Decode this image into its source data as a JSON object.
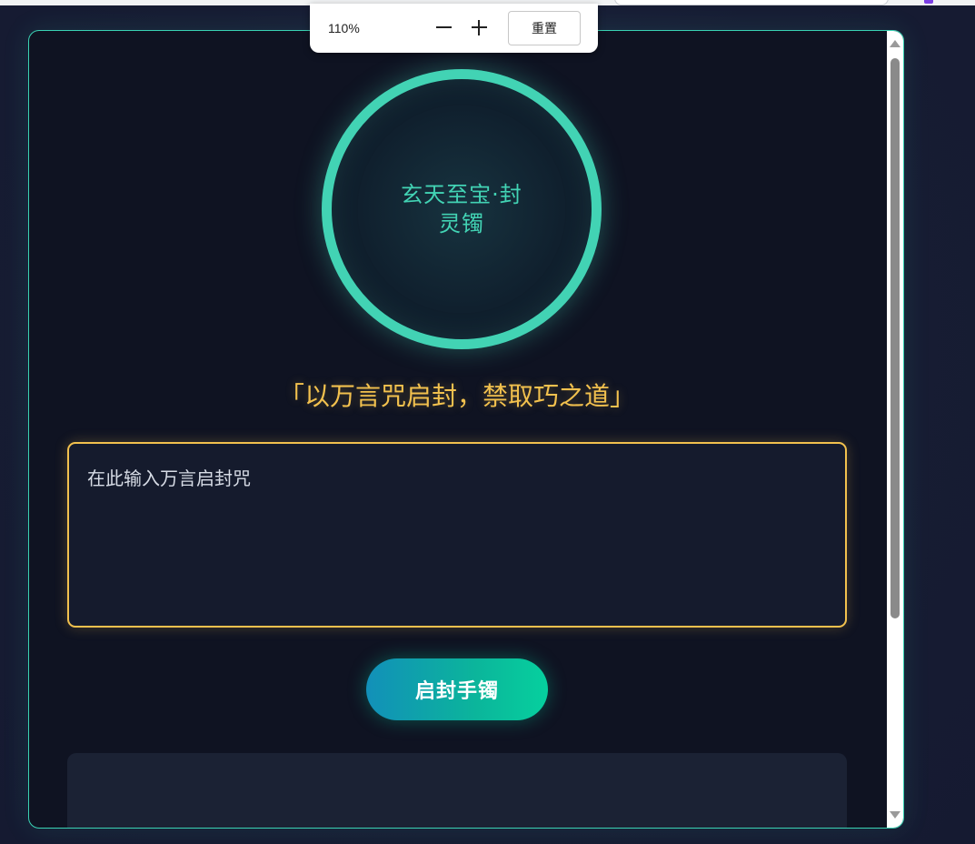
{
  "zoom_popup": {
    "level": "110%",
    "zoom_out_icon": "minus-icon",
    "zoom_in_icon": "plus-icon",
    "reset_label": "重置"
  },
  "amulet": {
    "title": "玄天至宝·封灵镯"
  },
  "incantation": "「以万言咒启封，禁取巧之道」",
  "spell_input": {
    "placeholder": "在此输入万言启封咒",
    "value": ""
  },
  "unseal_button": {
    "label": "启封手镯"
  },
  "colors": {
    "accent_teal": "#42d3b4",
    "accent_gold": "#f2c14e",
    "background": "#0f1322"
  }
}
